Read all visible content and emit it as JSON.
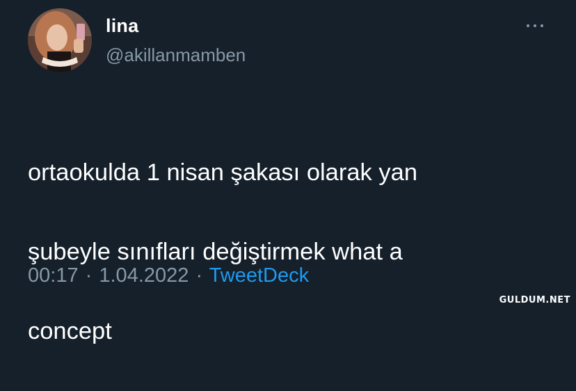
{
  "author": {
    "display_name": "lina",
    "handle": "@akillanmamben",
    "avatar_icon": "profile-photo"
  },
  "tweet": {
    "text_lines": [
      "ortaokulda 1 nisan şakası olarak yan",
      "şubeyle sınıfları değiştirmek what a",
      "concept"
    ],
    "time": "00:17",
    "separator": "·",
    "date": "1.04.2022",
    "source": "TweetDeck"
  },
  "more_icon": "more-horizontal-icon",
  "watermark": "GULDUM.NET",
  "colors": {
    "background": "#15202b",
    "primary_text": "#ffffff",
    "secondary_text": "#8899a6",
    "link": "#1d9bf0"
  }
}
